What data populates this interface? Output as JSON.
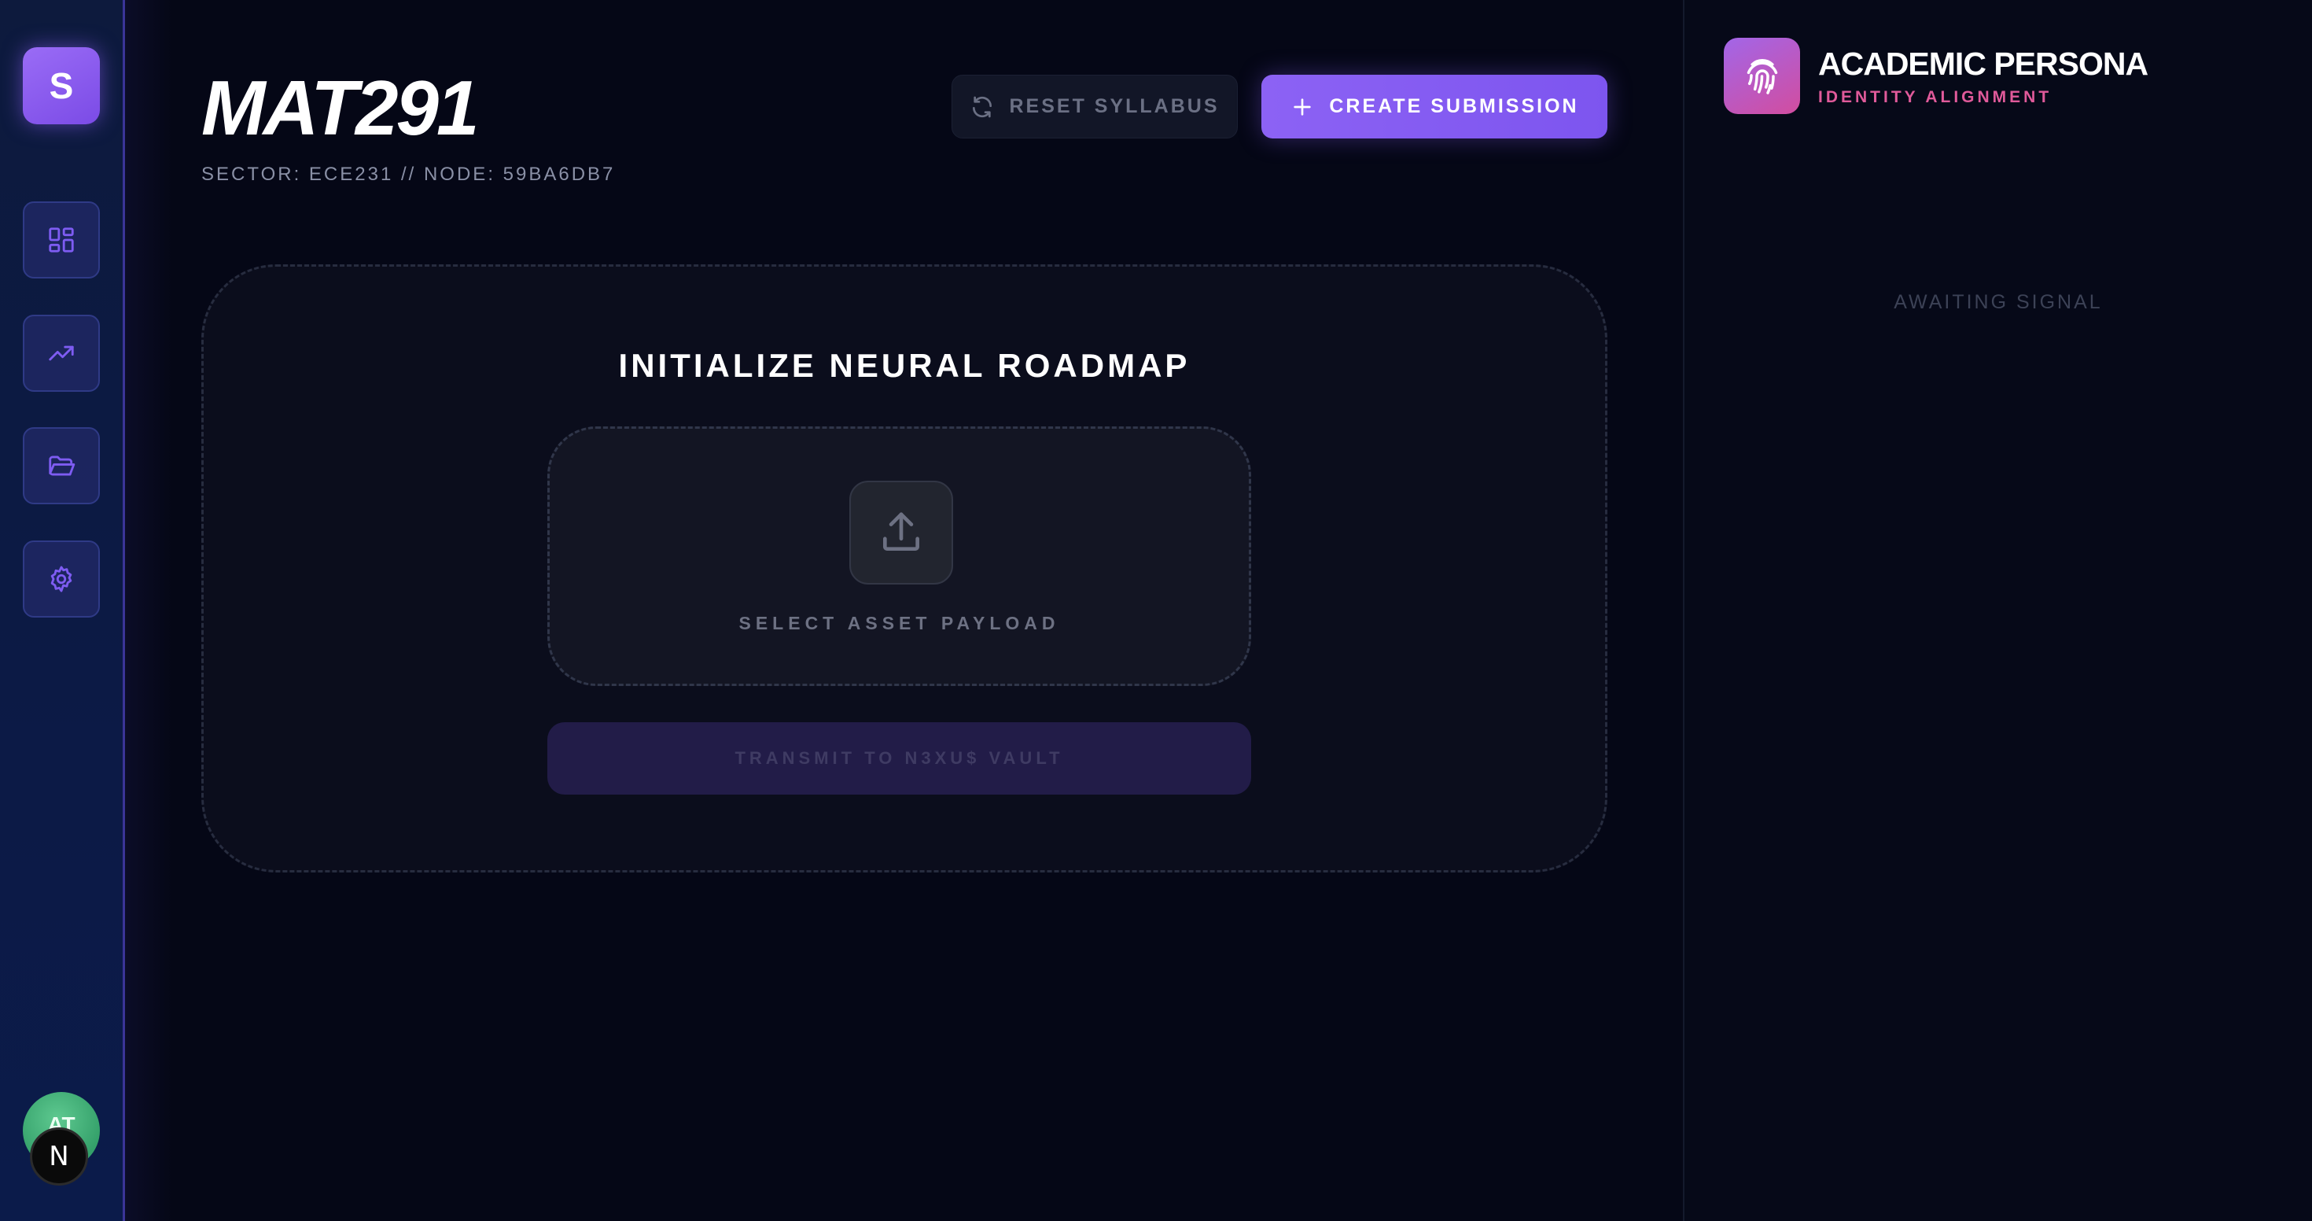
{
  "sidebar": {
    "logo_letter": "S",
    "nav": [
      {
        "icon": "dashboard-icon"
      },
      {
        "icon": "trending-up-icon"
      },
      {
        "icon": "folder-open-icon"
      },
      {
        "icon": "gear-icon"
      }
    ],
    "avatar_initials": "AT",
    "badge_letter": "N"
  },
  "header": {
    "title": "MAT291",
    "subtitle": "SECTOR: ECE231 // NODE: 59BA6DB7",
    "reset_label": "RESET SYLLABUS",
    "create_label": "CREATE SUBMISSION"
  },
  "roadmap": {
    "title": "INITIALIZE NEURAL ROADMAP",
    "dropzone_label": "SELECT ASSET PAYLOAD",
    "transmit_label": "TRANSMIT TO N3XU$ VAULT"
  },
  "persona": {
    "title": "ACADEMIC PERSONA",
    "subtitle": "IDENTITY ALIGNMENT",
    "status": "AWAITING SIGNAL"
  },
  "colors": {
    "accent": "#8c62f4",
    "pink": "#e05a9a",
    "background": "#050716",
    "sidebar": "#0c1a45"
  }
}
